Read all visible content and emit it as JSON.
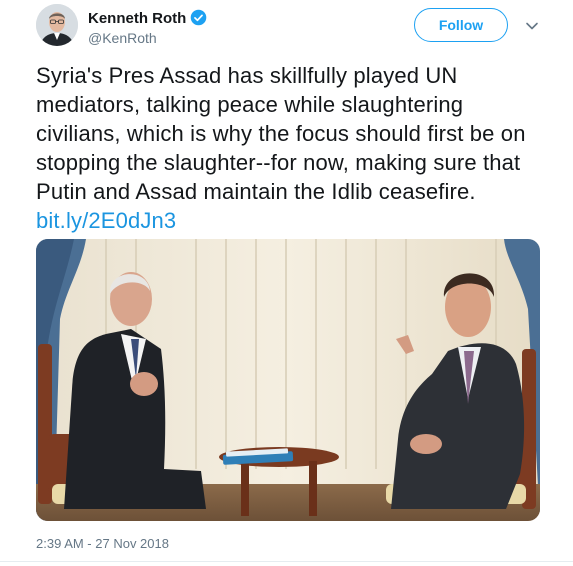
{
  "user": {
    "name": "Kenneth Roth",
    "handle": "@KenRoth",
    "verified": true
  },
  "actions": {
    "follow_label": "Follow",
    "menu_icon": "chevron-down-icon"
  },
  "tweet": {
    "text": "Syria's Pres Assad has skillfully played UN mediators, talking peace while slaughtering civilians, which is why the focus should first be on stopping the slaughter--for now, making sure that Putin and Assad maintain the Idlib ceasefire.",
    "link": "bit.ly/2E0dJn3",
    "timestamp": "2:39 AM - 27 Nov 2018"
  },
  "colors": {
    "accent": "#1da1f2",
    "link": "#1b95e0",
    "muted": "#657786",
    "text": "#14171a"
  }
}
